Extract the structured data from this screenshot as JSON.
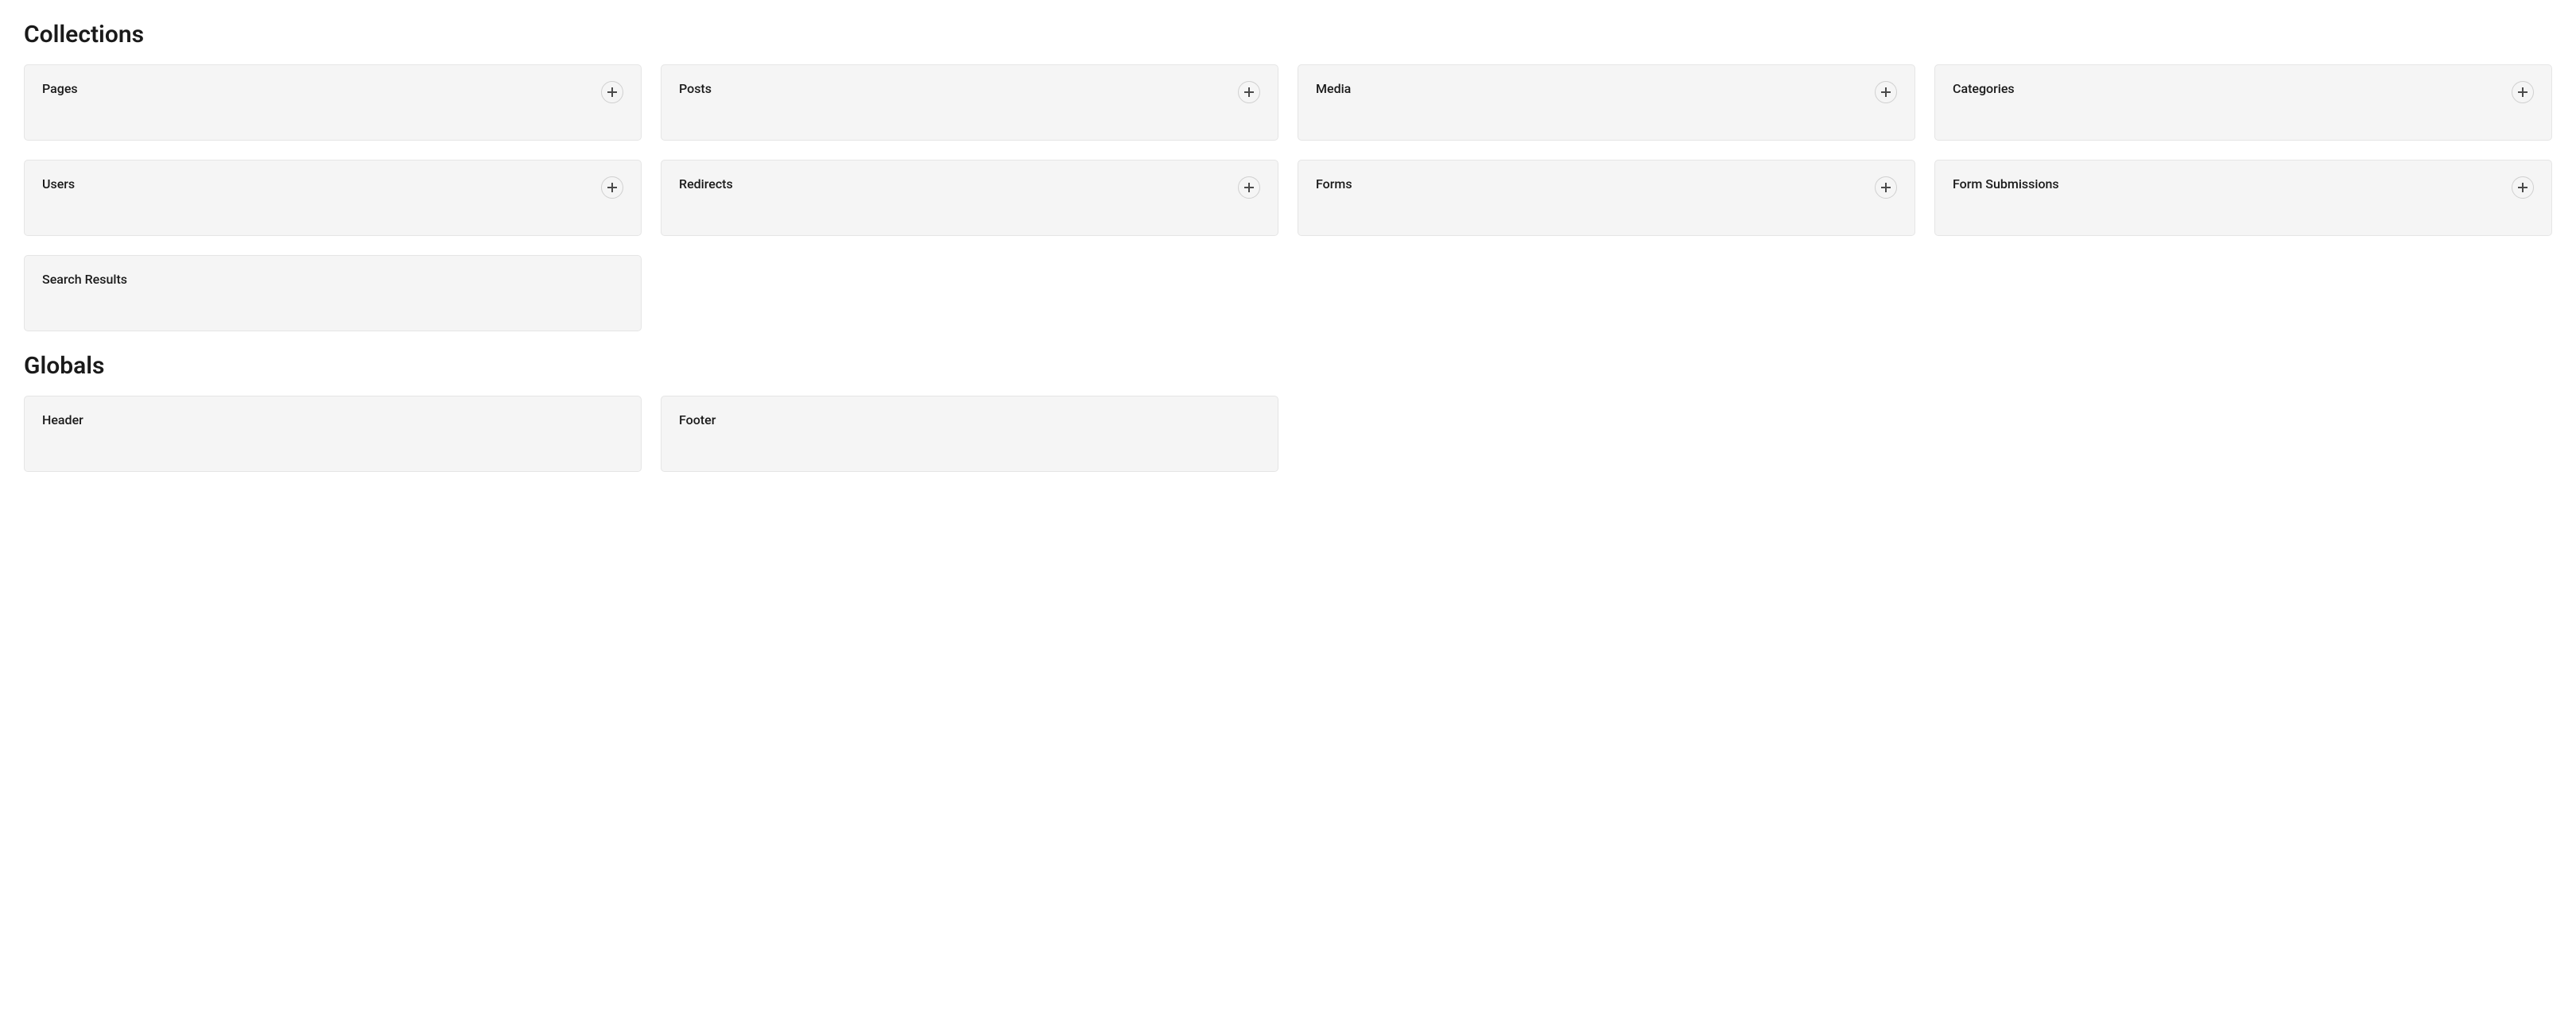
{
  "collections": {
    "title": "Collections",
    "items": [
      {
        "label": "Pages",
        "hasAdd": true
      },
      {
        "label": "Posts",
        "hasAdd": true
      },
      {
        "label": "Media",
        "hasAdd": true
      },
      {
        "label": "Categories",
        "hasAdd": true
      },
      {
        "label": "Users",
        "hasAdd": true
      },
      {
        "label": "Redirects",
        "hasAdd": true
      },
      {
        "label": "Forms",
        "hasAdd": true
      },
      {
        "label": "Form Submissions",
        "hasAdd": true
      },
      {
        "label": "Search Results",
        "hasAdd": false
      }
    ]
  },
  "globals": {
    "title": "Globals",
    "items": [
      {
        "label": "Header",
        "hasAdd": false
      },
      {
        "label": "Footer",
        "hasAdd": false
      }
    ]
  }
}
